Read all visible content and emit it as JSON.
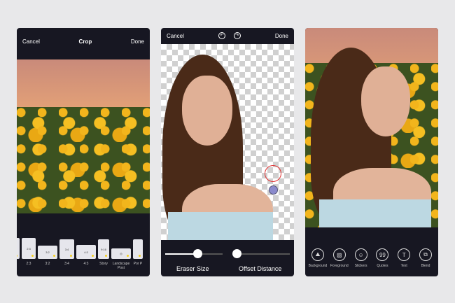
{
  "crop_screen": {
    "cancel": "Cancel",
    "title": "Crop",
    "done": "Done",
    "ratios": [
      {
        "label": "",
        "inner": ""
      },
      {
        "label": "2:3",
        "inner": "2:3"
      },
      {
        "label": "3:2",
        "inner": "3:2"
      },
      {
        "label": "3:4",
        "inner": "3:4"
      },
      {
        "label": "4:3",
        "inner": "4:3"
      },
      {
        "label": "Story",
        "inner": "9:16"
      },
      {
        "label": "Landscape Post",
        "inner": "◎"
      },
      {
        "label": "Por P",
        "inner": ""
      }
    ]
  },
  "erase_screen": {
    "cancel": "Cancel",
    "done": "Done",
    "undo_icon": "undo-icon",
    "redo_icon": "redo-icon",
    "eraser_size_label": "Eraser Size",
    "offset_distance_label": "Offset Distance",
    "eraser_size": 0.5,
    "offset_distance": 0.0
  },
  "edit_screen": {
    "tools": [
      {
        "label": "Background",
        "icon": "⛰"
      },
      {
        "label": "Foreground",
        "icon": "▨"
      },
      {
        "label": "Stickers",
        "icon": "☺"
      },
      {
        "label": "Quotes",
        "icon": "99"
      },
      {
        "label": "Text",
        "icon": "T"
      },
      {
        "label": "Blend",
        "icon": "⧉"
      }
    ]
  },
  "colors": {
    "background": "#e8e8ea",
    "phone": "#171722",
    "brush_ring": "#e03030",
    "brush_dot": "#8a8acc"
  }
}
